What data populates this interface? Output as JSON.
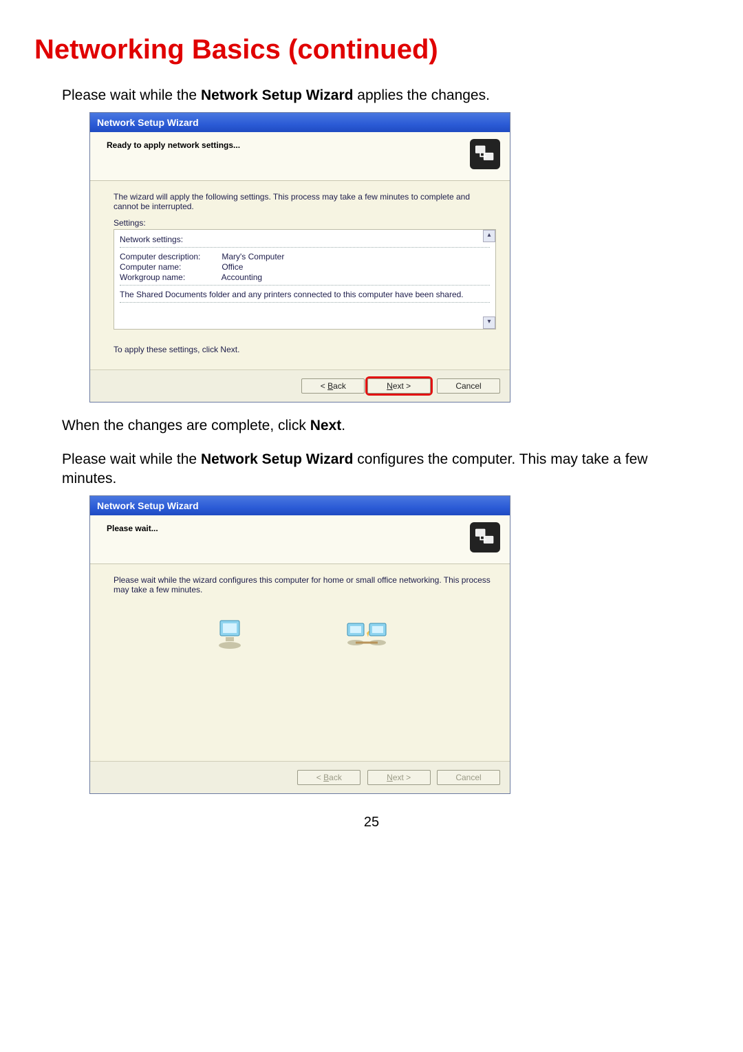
{
  "page": {
    "title": "Networking Basics (continued)",
    "intro_pre": "Please wait while the ",
    "intro_bold": "Network Setup Wizard",
    "intro_post": " applies the changes.",
    "mid1_pre": "When the changes are complete, click ",
    "mid1_bold": "Next",
    "mid1_post": ".",
    "mid2_pre": "Please wait while the ",
    "mid2_bold": "Network Setup Wizard",
    "mid2_post": " configures the computer. This may take a few minutes.",
    "number": "25"
  },
  "wizard1": {
    "title": "Network Setup Wizard",
    "header": "Ready to apply network settings...",
    "body_text": "The wizard will apply the following settings. This process may take a few minutes to complete and cannot be interrupted.",
    "settings_label": "Settings:",
    "panel": {
      "heading": "Network settings:",
      "rows": [
        {
          "label": "Computer description:",
          "value": "Mary's Computer"
        },
        {
          "label": "Computer name:",
          "value": "Office"
        },
        {
          "label": "Workgroup name:",
          "value": "Accounting"
        }
      ],
      "footer": "The Shared Documents folder and any printers connected to this computer have been shared."
    },
    "apply_hint": "To apply these settings, click Next.",
    "buttons": {
      "back": "< Back",
      "next": "Next >",
      "cancel": "Cancel"
    }
  },
  "wizard2": {
    "title": "Network Setup Wizard",
    "header": "Please wait...",
    "body_text": "Please wait while the wizard configures this computer for home or small office networking. This process may take a few minutes.",
    "buttons": {
      "back": "< Back",
      "next": "Next >",
      "cancel": "Cancel"
    }
  }
}
